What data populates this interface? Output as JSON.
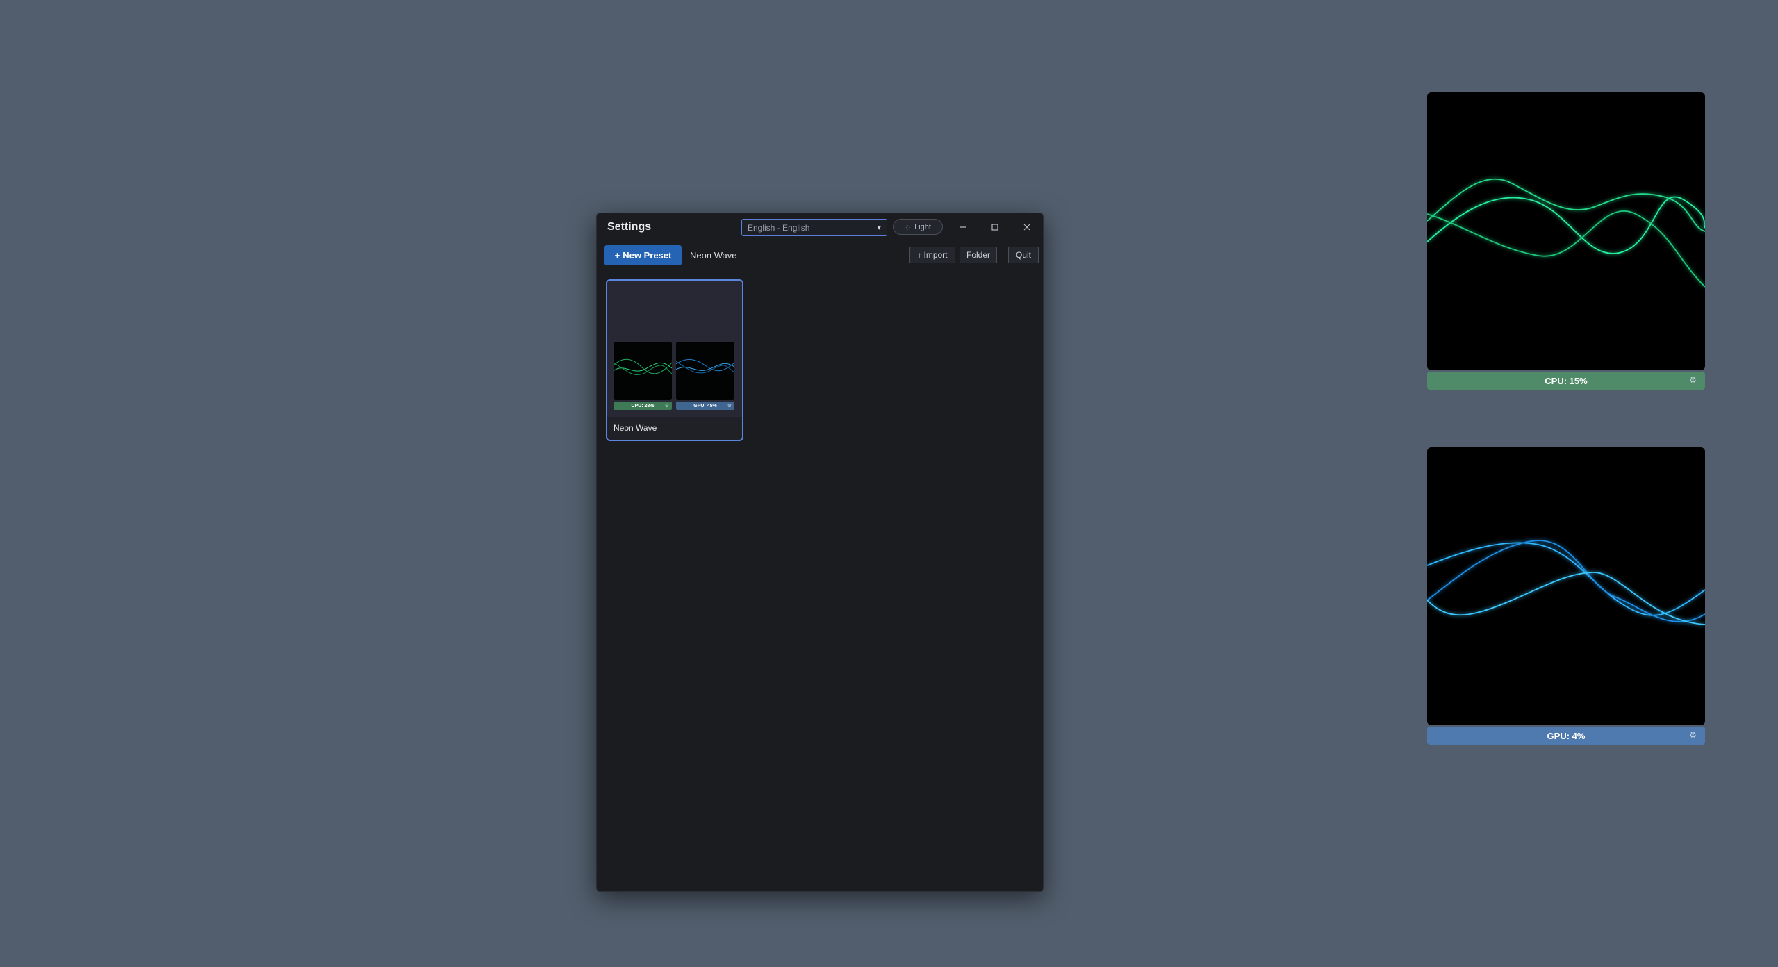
{
  "window": {
    "title": "Settings",
    "language": "English - English",
    "theme_button": "Light",
    "theme_icon": "sun-icon"
  },
  "toolbar": {
    "new_preset": "New Preset",
    "current_preset": "Neon Wave",
    "import": "Import",
    "folder": "Folder",
    "quit": "Quit"
  },
  "presets": [
    {
      "name": "Neon Wave",
      "cpu_label": "CPU: 28%",
      "gpu_label": "GPU: 45%"
    }
  ],
  "widgets": {
    "cpu": {
      "label": "CPU: 15%",
      "bar_color": "#4f8b68",
      "wave_color": "#2ee68f"
    },
    "gpu": {
      "label": "GPU: 4%",
      "bar_color": "#4f7aaf",
      "wave_color": "#2fb6ff"
    }
  },
  "colors": {
    "desktop": "#525e6d",
    "window_bg": "#1a1c20",
    "accent": "#2563b4",
    "selection": "#5a86e0"
  }
}
